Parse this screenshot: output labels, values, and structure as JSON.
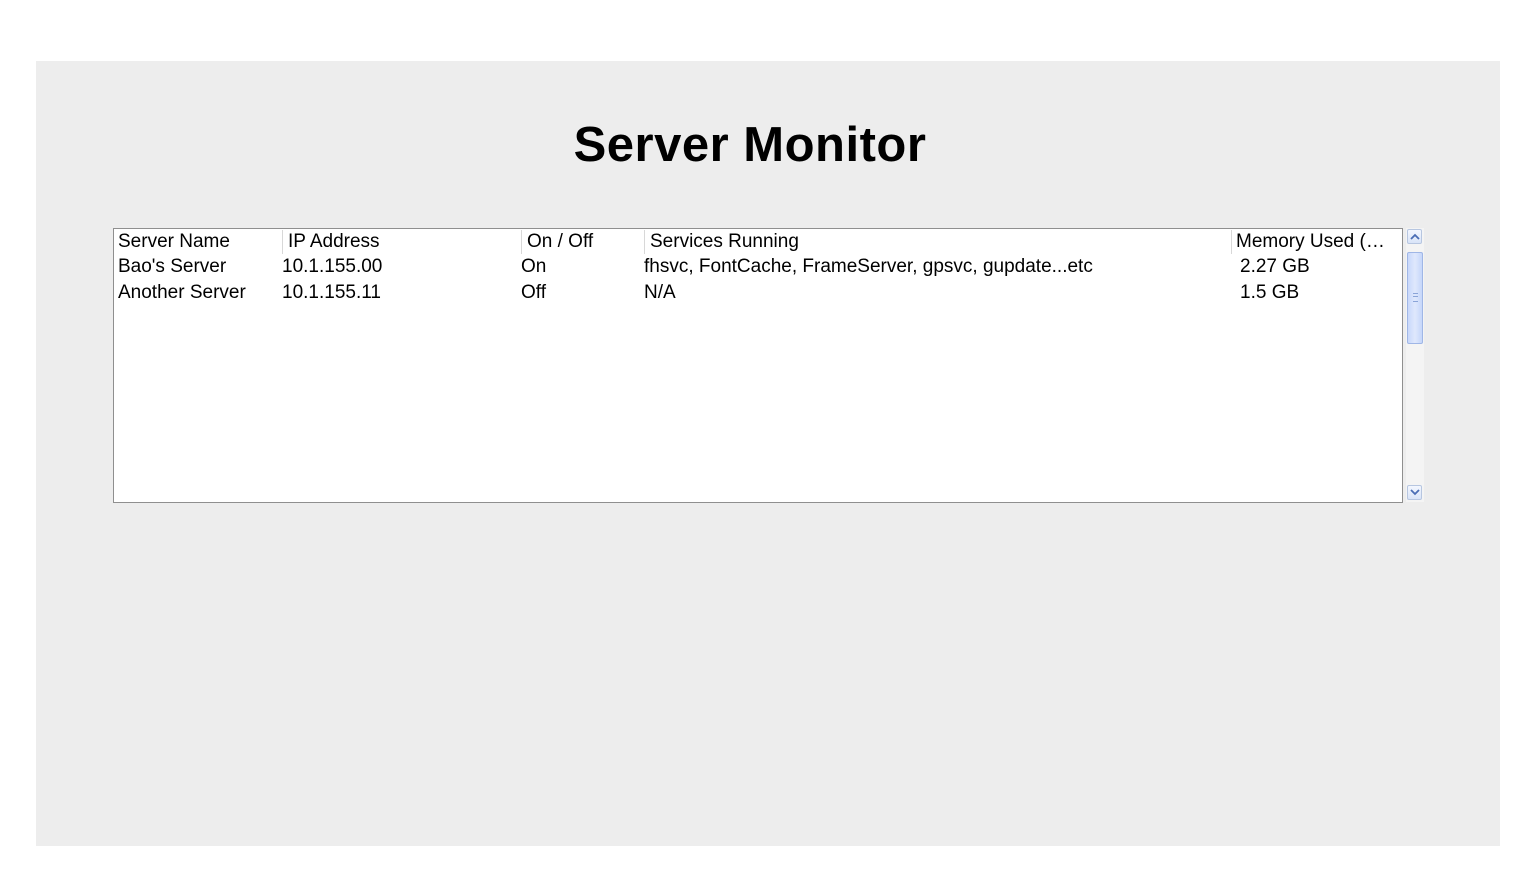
{
  "page": {
    "title": "Server Monitor"
  },
  "table": {
    "columns": [
      "Server Name",
      "IP Address",
      "On / Off",
      "Services Running",
      "Memory Used (…"
    ],
    "rows": [
      {
        "server_name": "Bao's Server",
        "ip_address": "10.1.155.00",
        "status": "On",
        "services": "fhsvc, FontCache, FrameServer, gpsvc, gupdate...etc",
        "memory": "2.27 GB"
      },
      {
        "server_name": "Another Server",
        "ip_address": "10.1.155.11",
        "status": "Off",
        "services": "N/A",
        "memory": "1.5 GB"
      }
    ]
  },
  "scrollbar": {
    "up_icon": "chevron-up-icon",
    "down_icon": "chevron-down-icon",
    "accent": "#c8d8fb"
  },
  "colors": {
    "window_bg": "#ededed",
    "table_bg": "#ffffff",
    "border": "#8f8f8f"
  }
}
